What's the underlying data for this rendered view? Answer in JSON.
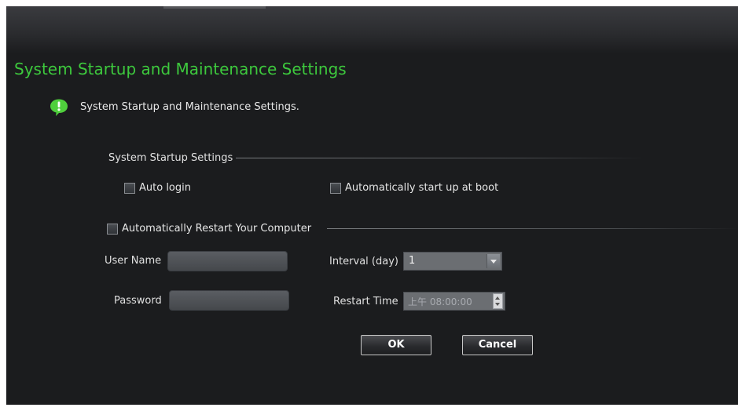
{
  "header": {
    "title": "System Startup and Maintenance Settings"
  },
  "info": {
    "text": "System Startup and Maintenance Settings.",
    "icon": "info-speech-icon"
  },
  "startup": {
    "section_label": "System Startup Settings",
    "auto_login_label": "Auto login",
    "auto_login_checked": false,
    "boot_label": "Automatically start up at boot",
    "boot_checked": false
  },
  "restart": {
    "checkbox_label": "Automatically Restart Your Computer",
    "checked": false,
    "user_name_label": "User Name",
    "user_name_value": "",
    "password_label": "Password",
    "password_value": "",
    "interval_label": "Interval (day)",
    "interval_value": "1",
    "restart_time_label": "Restart Time",
    "restart_time_value": "上午 08:00:00"
  },
  "buttons": {
    "ok": "OK",
    "cancel": "Cancel"
  },
  "colors": {
    "accent": "#3dc83d",
    "background": "#1b1c1e"
  }
}
